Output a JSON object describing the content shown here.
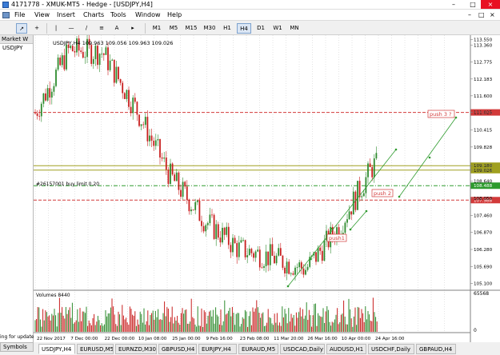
{
  "window": {
    "title": "4171778 - XMUK-MT5 - Hedge - [USDJPY,H4]",
    "controls": [
      "–",
      "□",
      "×"
    ]
  },
  "menu": [
    "File",
    "View",
    "Insert",
    "Charts",
    "Tools",
    "Window",
    "Help"
  ],
  "mdi_controls": [
    "–",
    "□",
    "×"
  ],
  "toolbar": {
    "tools": [
      "↗",
      "+",
      "|",
      "—",
      "∕",
      "≡",
      "A",
      "▸"
    ],
    "timeframes": [
      "M1",
      "M5",
      "M15",
      "M30",
      "H1",
      "H4",
      "D1",
      "W1",
      "MN"
    ],
    "active_timeframe": "H4"
  },
  "market_watch": {
    "header": "Market W",
    "symbol": "USDJPY",
    "footer": "ing for update",
    "tab": "Symbols"
  },
  "chart": {
    "info": "USDJPY,H4  109.963 109.056 109.963 109.026",
    "order_label": "#26157001 buy limit 0.20",
    "annotations": [
      "push 3 ?",
      "push 2",
      "push1"
    ],
    "volume_label": "Volumes 8440",
    "volume_axis": [
      "65568",
      "0"
    ],
    "colors": {
      "bull": "#2e8b2e",
      "bear": "#c81e1e",
      "accent": "#2e9b2e"
    }
  },
  "chart_data": {
    "type": "candlestick",
    "price_ticks": [
      "113.550",
      "113.360",
      "112.775",
      "112.183",
      "111.600",
      "111.025",
      "110.415",
      "109.828",
      "109.180",
      "109.026",
      "108.640",
      "108.050",
      "107.460",
      "106.870",
      "106.280",
      "105.690",
      "105.100"
    ],
    "x_ticks": [
      "22 Nov 2017",
      "7 Dec 00:00",
      "22 Dec 00:00",
      "10 Jan 08:00",
      "25 Jan 00:00",
      "9 Feb 16:00",
      "23 Feb 08:00",
      "11 Mar 20:00",
      "26 Mar 16:00",
      "10 Apr 00:00",
      "24 Apr 16:00"
    ],
    "levels": [
      {
        "price": "111.025",
        "color": "#d23a3a",
        "style": "dashed"
      },
      {
        "price": "109.180",
        "color": "#a0a020",
        "style": "solid"
      },
      {
        "price": "109.026",
        "color": "#a0a020",
        "style": "solid"
      },
      {
        "price": "108.488",
        "color": "#2e9b2e",
        "style": "dashdot"
      },
      {
        "price": "107.988",
        "color": "#d23a3a",
        "style": "dashed"
      }
    ],
    "close_path": [
      {
        "x": "22 Nov 2017",
        "y": 111.0
      },
      {
        "x": "7 Dec 00:00",
        "y": 113.2
      },
      {
        "x": "22 Dec 00:00",
        "y": 113.1
      },
      {
        "x": "10 Jan 08:00",
        "y": 111.1
      },
      {
        "x": "25 Jan 00:00",
        "y": 108.8
      },
      {
        "x": "9 Feb 16:00",
        "y": 107.3
      },
      {
        "x": "23 Feb 08:00",
        "y": 106.3
      },
      {
        "x": "11 Mar 20:00",
        "y": 106.0
      },
      {
        "x": "26 Mar 16:00",
        "y": 105.6
      },
      {
        "x": "10 Apr 00:00",
        "y": 107.1
      },
      {
        "x": "24 Apr 16:00",
        "y": 109.2
      }
    ]
  },
  "tabs": [
    "USDJPY,H4",
    "EURUSD,M5",
    "EURNZD,M30",
    "GBPUSD,H4",
    "EURJPY,H4",
    "EURAUD,M5",
    "USDCAD,Daily",
    "AUDUSD,H1",
    "USDCHF,Daily",
    "GBPAUD,H4"
  ],
  "active_tab": "USDJPY,H4"
}
